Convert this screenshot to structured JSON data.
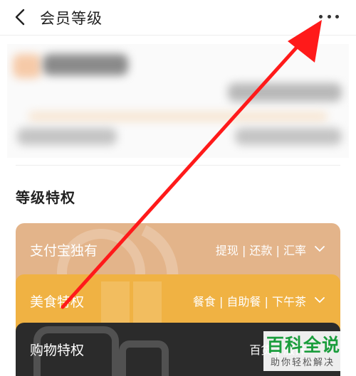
{
  "nav": {
    "title": "会员等级"
  },
  "section": {
    "title": "等级特权"
  },
  "cards": [
    {
      "name": "支付宝独有",
      "tags": "提现 | 还款 | 汇率"
    },
    {
      "name": "美食特权",
      "tags": "餐食 | 自助餐 | 下午茶"
    },
    {
      "name": "购物特权",
      "tags": "百货 | 服饰"
    }
  ],
  "watermark": {
    "main": "百科全说",
    "sub": "助你轻松解决"
  },
  "colors": {
    "annotation_arrow": "#ff1a1a",
    "card_alipay": "#e3b48a",
    "card_food": "#f0b243",
    "card_shop": "#2b2b2b",
    "watermark_green": "#1a9d3c"
  },
  "icons": [
    "back-icon",
    "more-icon",
    "chevron-down-icon"
  ]
}
